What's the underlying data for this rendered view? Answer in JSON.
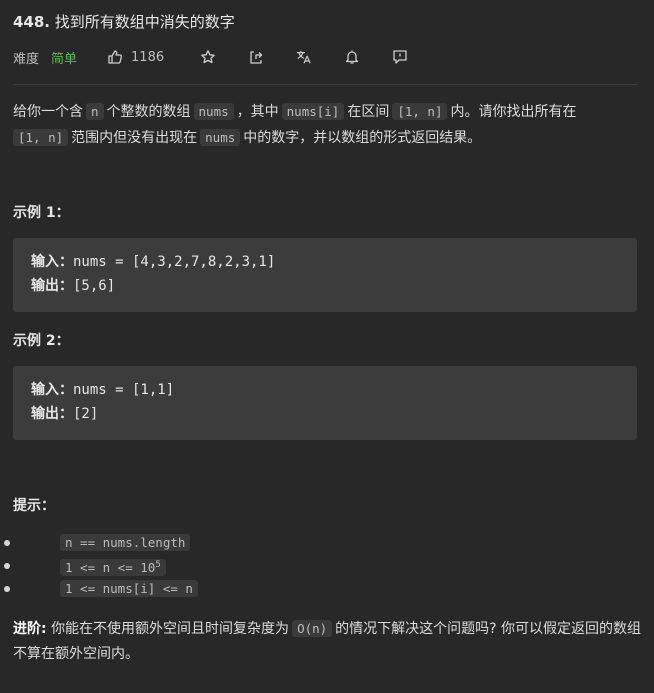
{
  "problem": {
    "number": "448.",
    "name": "找到所有数组中消失的数字"
  },
  "meta": {
    "difficulty_label": "难度",
    "difficulty": "简单",
    "likes": "1186",
    "icons": [
      "thumbs-up-icon",
      "star-icon",
      "share-icon",
      "translate-icon",
      "bell-icon",
      "feedback-icon"
    ],
    "difficulty_color": "#5cb85c"
  },
  "description": {
    "p1": "给你一个含",
    "c1": "n",
    "p2": "个整数的数组",
    "c2": "nums",
    "p3": "，其中",
    "c3": "nums[i]",
    "p4": "在区间",
    "c4": "[1, n]",
    "p5": "内。请你找出所有在",
    "c5": "[1, n]",
    "p6": "范围内但没有出现在",
    "c6": "nums",
    "p7": "中的数字，并以数组的形式返回结果。"
  },
  "examples": [
    {
      "title": "示例 1：",
      "input_label": "输入：",
      "input": "nums = [4,3,2,7,8,2,3,1]",
      "output_label": "输出：",
      "output": "[5,6]"
    },
    {
      "title": "示例 2：",
      "input_label": "输入：",
      "input": "nums = [1,1]",
      "output_label": "输出：",
      "output": "[2]"
    }
  ],
  "hints": {
    "title": "提示：",
    "items": [
      "n == nums.length",
      "1 <= n <= 10",
      "1 <= nums[i] <= n"
    ],
    "exponent": "5"
  },
  "advanced": {
    "label": "进阶:",
    "t1": "你能在不使用额外空间且时间复杂度为",
    "code": "O(n)",
    "t2": "的情况下解决这个问题吗? 你可以假定返回的数组不算在额外空间内。"
  }
}
